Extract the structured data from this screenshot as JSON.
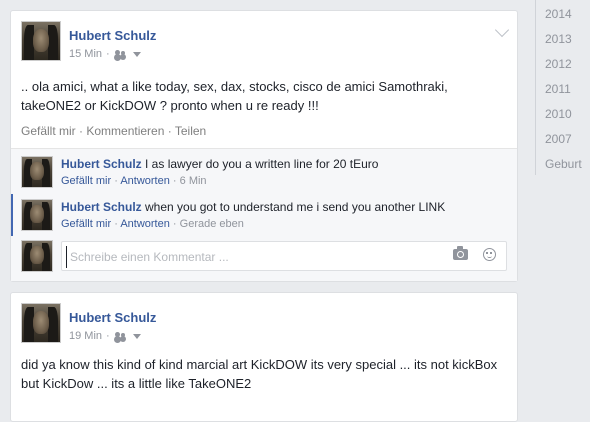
{
  "sidebar": {
    "years": [
      "2014",
      "2013",
      "2012",
      "2011",
      "2010",
      "2007",
      "Geburt"
    ]
  },
  "post1": {
    "author": "Hubert Schulz",
    "time": "15 Min",
    "audience_icon": "friends-icon",
    "text": ".. ola amici, what a like today, sex, dax, stocks, cisco de amici Samothraki, takeONE2 or KickDOW ? pronto when u re ready !!!",
    "actions": {
      "like": "Gefällt mir",
      "comment": "Kommentieren",
      "share": "Teilen",
      "separator": " · "
    },
    "comments": [
      {
        "author": "Hubert Schulz",
        "text": "I as lawyer do you a written line for 20 tEuro",
        "like": "Gefällt mir",
        "reply": "Antworten",
        "time": "6 Min"
      },
      {
        "author": "Hubert Schulz",
        "text": "when you got to understand me i send you another LINK",
        "like": "Gefällt mir",
        "reply": "Antworten",
        "time": "Gerade eben"
      }
    ],
    "comment_input": {
      "placeholder": "Schreibe einen Kommentar ..."
    }
  },
  "post2": {
    "author": "Hubert Schulz",
    "time": "19 Min",
    "audience_icon": "friends-icon",
    "text": "did ya know this kind of kind marcial art KickDOW its very special ... its not kickBox but KickDow ... its a little like TakeONE2"
  },
  "colors": {
    "name_link": "#365899",
    "background": "#e9ebee",
    "meta_gray": "#90949c"
  }
}
